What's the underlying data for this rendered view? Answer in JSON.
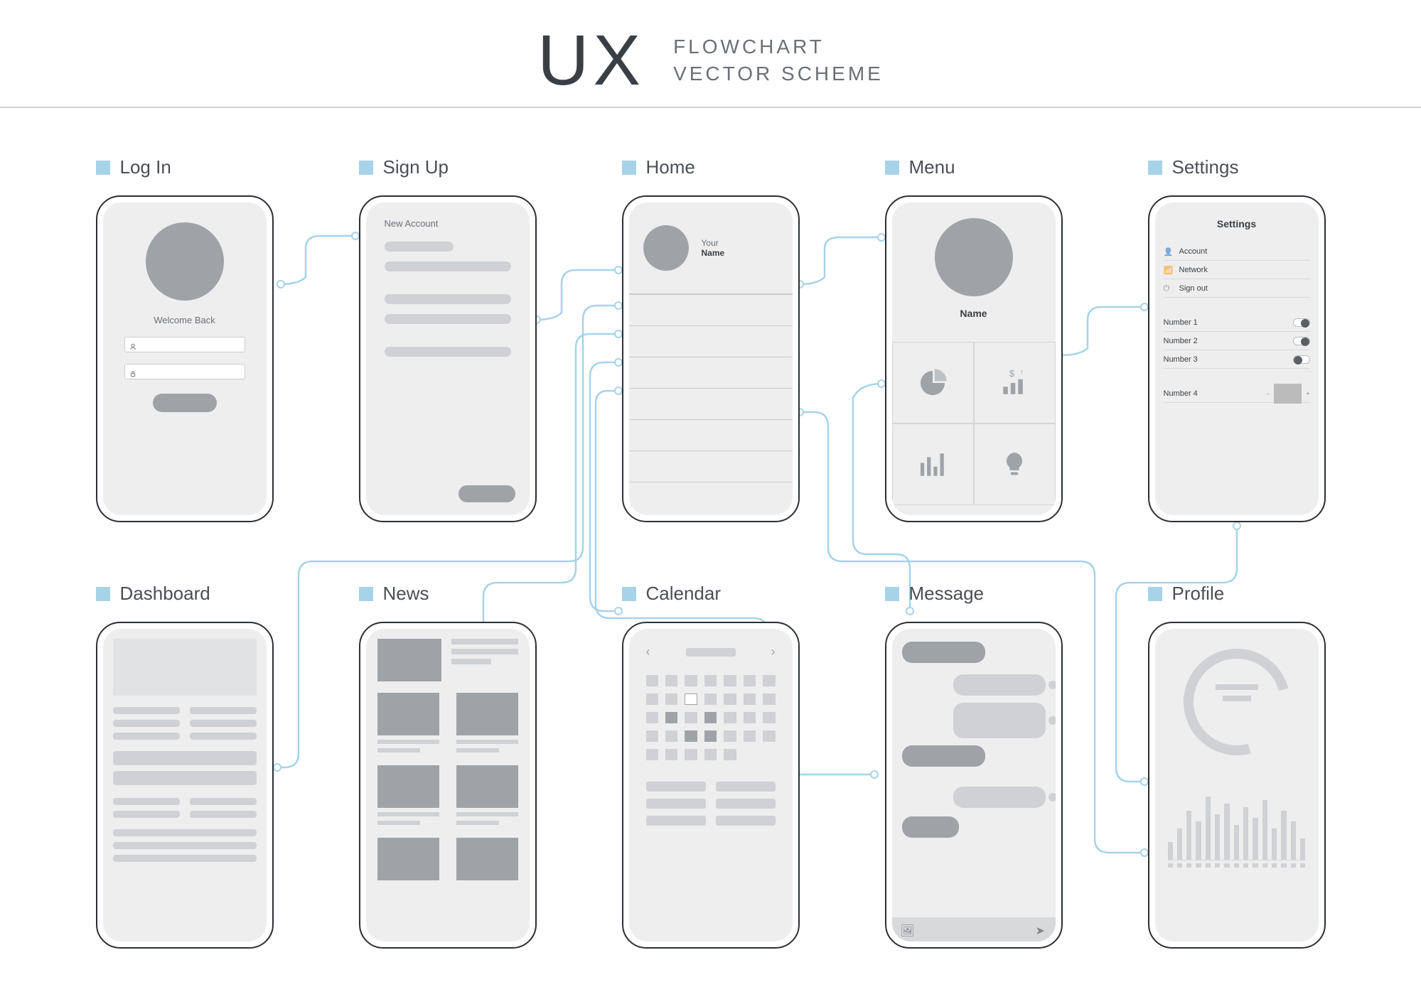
{
  "header": {
    "brand": "UX",
    "line1": "FLOWCHART",
    "line2": "VECTOR SCHEME"
  },
  "screens": {
    "login": {
      "label": "Log In",
      "welcome": "Welcome Back"
    },
    "signup": {
      "label": "Sign Up",
      "title": "New Account"
    },
    "home": {
      "label": "Home",
      "your": "Your",
      "name": "Name"
    },
    "menu": {
      "label": "Menu",
      "name": "Name",
      "icons": [
        "pie-chart-icon",
        "bar-growth-icon",
        "bar-chart-icon",
        "bulb-icon"
      ]
    },
    "settings": {
      "label": "Settings",
      "title": "Settings",
      "links": [
        "Account",
        "Network",
        "Sign out"
      ],
      "toggles": [
        {
          "label": "Number 1",
          "state": "on"
        },
        {
          "label": "Number 2",
          "state": "on"
        },
        {
          "label": "Number 3",
          "state": "off"
        }
      ],
      "slider": {
        "label": "Number 4"
      }
    },
    "dashboard": {
      "label": "Dashboard"
    },
    "news": {
      "label": "News"
    },
    "calendar": {
      "label": "Calendar"
    },
    "message": {
      "label": "Message"
    },
    "profile": {
      "label": "Profile"
    }
  },
  "chart_data": {
    "type": "bar",
    "title": "",
    "series": [
      {
        "name": "profile-mini-bars",
        "values": [
          25,
          45,
          70,
          55,
          90,
          65,
          80,
          50,
          75,
          60,
          85,
          45,
          70,
          55,
          30
        ]
      }
    ]
  },
  "connectors": [
    [
      "login",
      "signup"
    ],
    [
      "signup",
      "home"
    ],
    [
      "home",
      "menu"
    ],
    [
      "menu",
      "settings"
    ],
    [
      "home",
      "dashboard"
    ],
    [
      "home",
      "news"
    ],
    [
      "home",
      "calendar"
    ],
    [
      "home",
      "message"
    ],
    [
      "home",
      "profile"
    ],
    [
      "menu",
      "message"
    ],
    [
      "settings",
      "profile"
    ]
  ],
  "colors": {
    "accent": "#a7d3e8",
    "ink": "#4a4f56",
    "placeholder": "#cfd1d4"
  }
}
